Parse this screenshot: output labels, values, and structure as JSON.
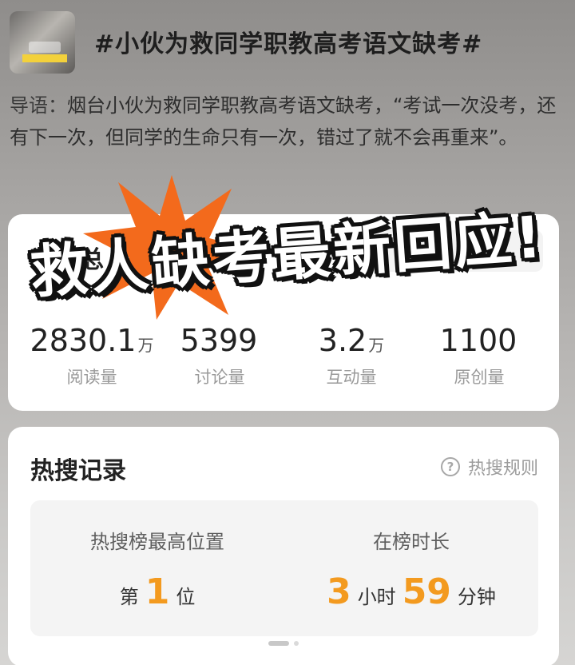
{
  "topic": {
    "title": "#小伙为救同学职教高考语文缺考#"
  },
  "intro": {
    "lead": "导语：",
    "text": "烟台小伙为救同学职教高考语文缺考，“考试一次没考，还有下一次，但同学的生命只有一次，错过了就不会再重来”。"
  },
  "overlay_caption": "救人缺考最新回应!",
  "data_card": {
    "title": "数据总",
    "stats": [
      {
        "value": "2830.1",
        "unit": "万",
        "label": "阅读量"
      },
      {
        "value": "5399",
        "unit": "",
        "label": "讨论量"
      },
      {
        "value": "3.2",
        "unit": "万",
        "label": "互动量"
      },
      {
        "value": "1100",
        "unit": "",
        "label": "原创量"
      }
    ]
  },
  "hot_card": {
    "title": "热搜记录",
    "rules_label": "热搜规则",
    "rules_icon": "question-circle-icon",
    "peak": {
      "title": "热搜榜最高位置",
      "prefix": "第",
      "value": "1",
      "suffix": "位"
    },
    "duration": {
      "title": "在榜时长",
      "hours": "3",
      "hours_unit": "小时",
      "minutes": "59",
      "minutes_unit": "分钟"
    }
  },
  "colors": {
    "accent": "#f39a1f",
    "burst": "#f36a1c",
    "card": "#ffffff"
  }
}
